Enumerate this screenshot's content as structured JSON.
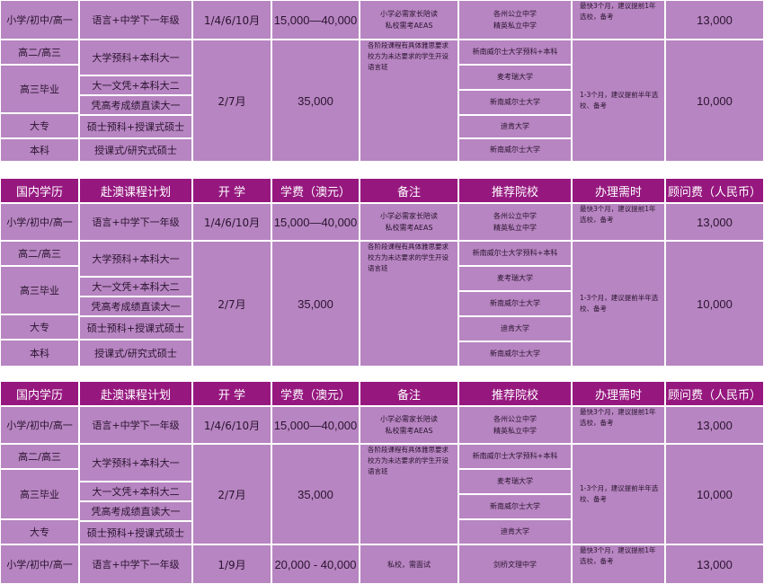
{
  "headers": [
    "国内学历",
    "赴澳课程计划",
    "开 学",
    "学费（澳元）",
    "备注",
    "推荐院校",
    "办理需时",
    "顾问费（人民币）"
  ],
  "row_first": {
    "level": "小学/初中/高一",
    "program": "语言+中学下一年级",
    "intake": "1/4/6/10月",
    "tuition": "15,000—40,000",
    "note": [
      "小学必需家长陪读",
      "私校需考AEAS"
    ],
    "school": [
      "各州公立中学",
      "精英私立中学"
    ],
    "time": [
      "最快3个月，建议提前1年",
      "选校，备考"
    ],
    "fee": "13,000"
  },
  "group": {
    "levels": [
      "高二/高三",
      "高三毕业",
      "大专",
      "本科"
    ],
    "programs": [
      "大学预科+本科大一",
      "大一文凭+本科大二",
      "凭高考成绩直读大一",
      "硕士预科+授课式硕士",
      "授课式/研究式硕士"
    ],
    "intake": "2/7月",
    "tuition": "35,000",
    "note": [
      "各阶段课程有具体雅思要求",
      "校方为未达要求的学生开设",
      "语言班"
    ],
    "schools": [
      "新南威尔士大学预科+本科",
      "麦考瑞大学",
      "新南威尔士大学",
      "迪肯大学",
      "新南威尔士大学"
    ],
    "time": "1-3个月，建议提前半年选校、备考",
    "fee": "10,000"
  },
  "last_row": {
    "level": "小学/初中/高一",
    "program": "语言+中学下一年级",
    "intake": "1/9月",
    "tuition": "20,000 - 40,000",
    "note": "私校，需面试",
    "school": "剑桥文理中学",
    "time": [
      "最快3个月，建议提前1年",
      "选校，备考"
    ],
    "fee": "13,000"
  },
  "colors": {
    "header_bg": "#96187f",
    "cell_bg": "#b785c1",
    "header_text": "#ffffff"
  }
}
